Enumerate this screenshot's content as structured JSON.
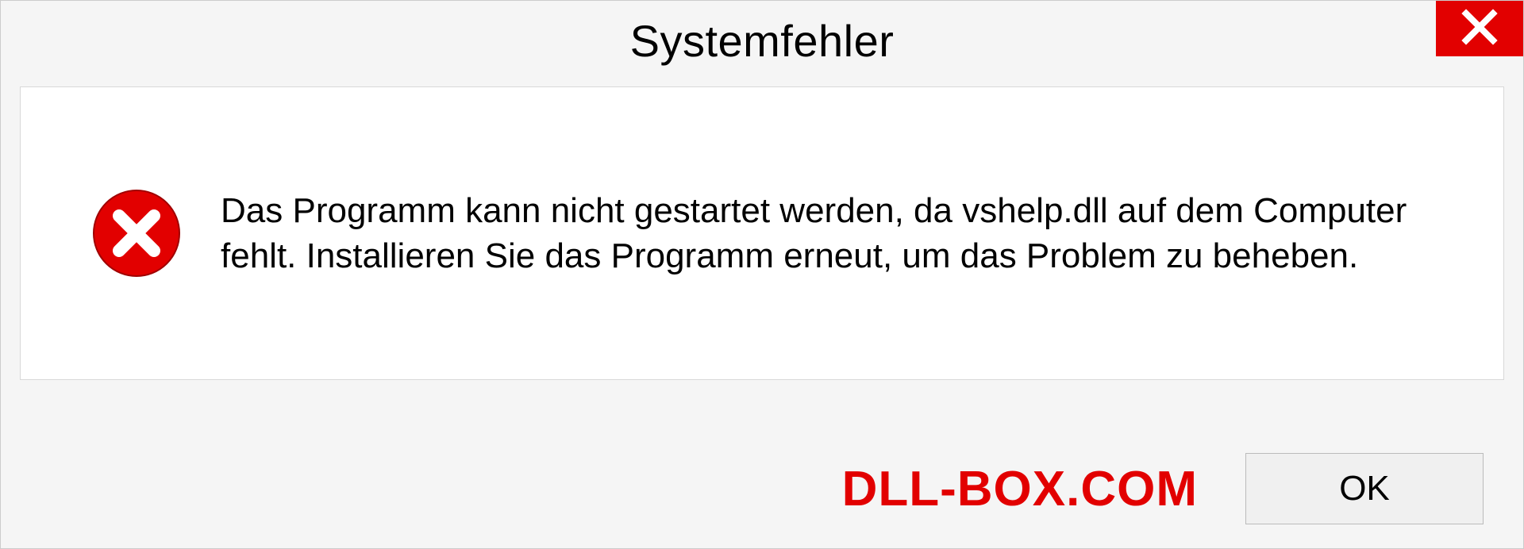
{
  "dialog": {
    "title": "Systemfehler",
    "message": "Das Programm kann nicht gestartet werden, da vshelp.dll auf dem Computer fehlt. Installieren Sie das Programm erneut, um das Problem zu beheben.",
    "ok_label": "OK"
  },
  "watermark": {
    "text": "DLL-BOX.COM"
  },
  "colors": {
    "accent_red": "#e20000",
    "background": "#f5f5f5"
  },
  "icons": {
    "close": "close-icon",
    "error": "error-circle-x-icon"
  }
}
